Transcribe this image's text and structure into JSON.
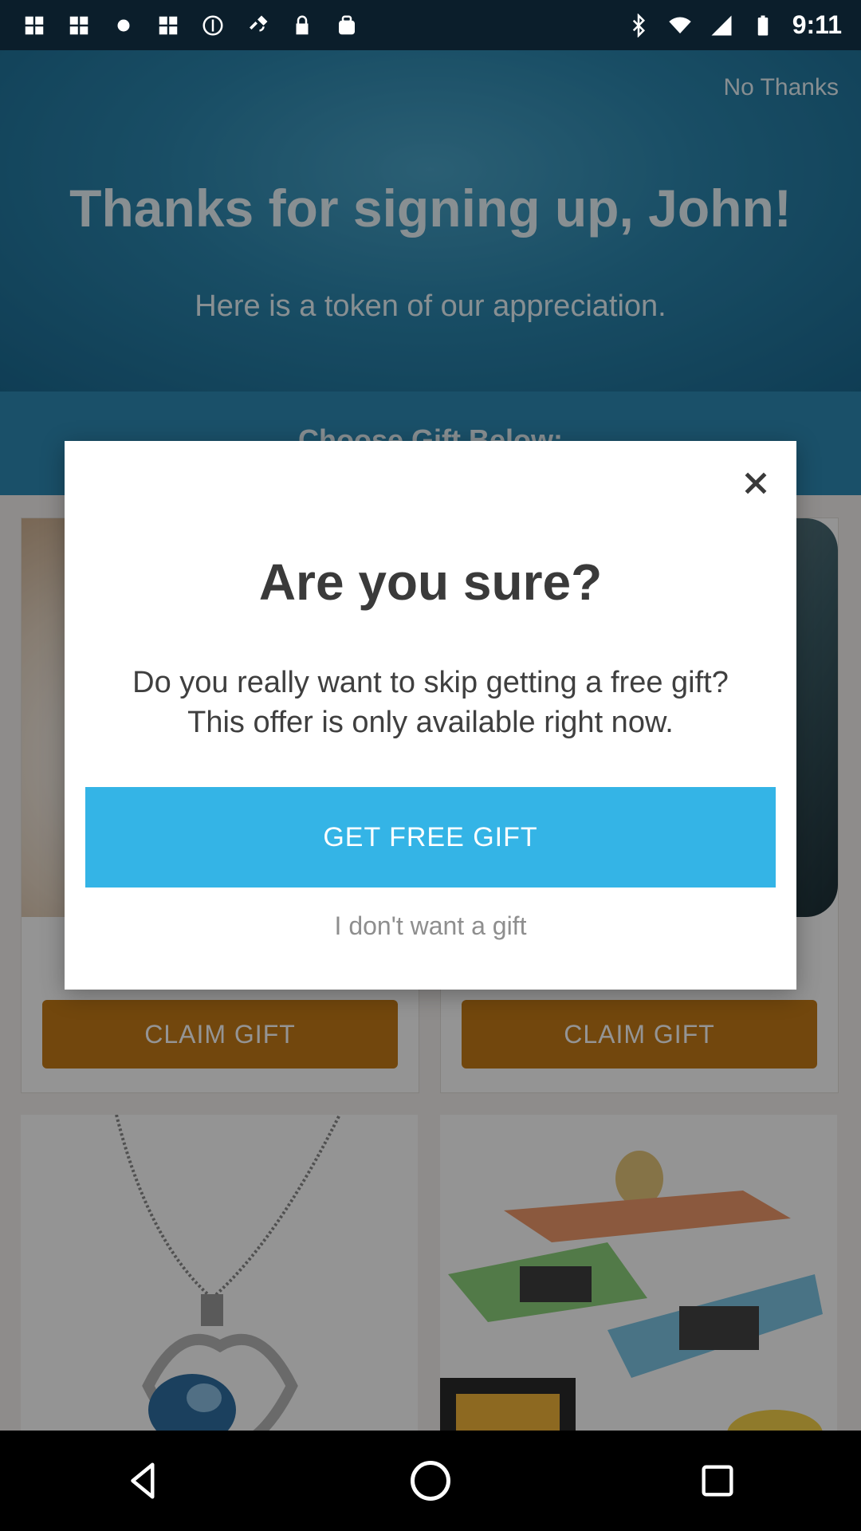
{
  "status_bar": {
    "time": "9:11",
    "left_icons": [
      "grid-icon",
      "grid-icon",
      "record-icon",
      "grid-icon",
      "sync-icon",
      "satellite-icon",
      "lock-icon",
      "bag-icon"
    ],
    "right_icons": [
      "bluetooth-icon",
      "wifi-icon",
      "signal-icon",
      "battery-icon"
    ]
  },
  "background_page": {
    "no_thanks": "No Thanks",
    "title": "Thanks for signing up, John!",
    "subtitle": "Here is a token of our appreciation.",
    "choose_label": "Choose Gift Below:",
    "cards": [
      {
        "button": "CLAIM GIFT"
      },
      {
        "button": "CLAIM GIFT"
      }
    ]
  },
  "dialog": {
    "title": "Are you sure?",
    "message": "Do you really want to skip getting a free gift? This offer is only available right now.",
    "primary_button": "GET FREE GIFT",
    "secondary_link": "I don't want a gift",
    "accent_color": "#34b4e6"
  },
  "nav_bar": {
    "buttons": [
      "back-icon",
      "home-icon",
      "recents-icon"
    ]
  }
}
